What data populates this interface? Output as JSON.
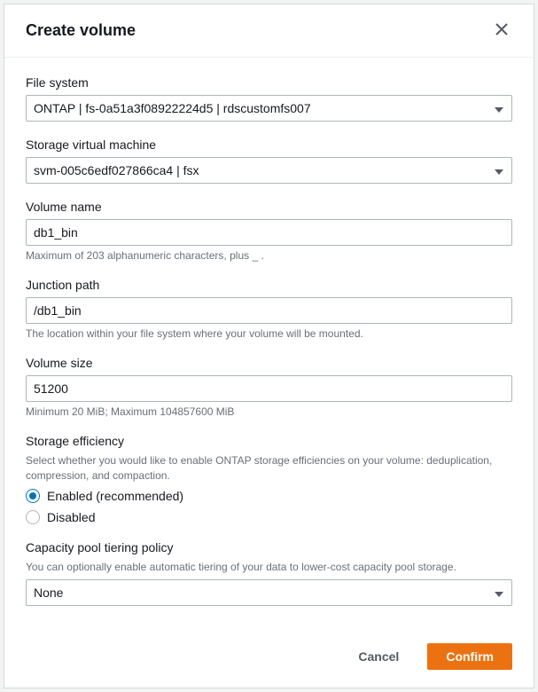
{
  "header": {
    "title": "Create volume"
  },
  "fields": {
    "file_system": {
      "label": "File system",
      "value": "ONTAP | fs-0a51a3f08922224d5 | rdscustomfs007"
    },
    "svm": {
      "label": "Storage virtual machine",
      "value": "svm-005c6edf027866ca4 | fsx"
    },
    "volume_name": {
      "label": "Volume name",
      "value": "db1_bin",
      "hint": "Maximum of 203 alphanumeric characters, plus _ ."
    },
    "junction_path": {
      "label": "Junction path",
      "value": "/db1_bin",
      "hint": "The location within your file system where your volume will be mounted."
    },
    "volume_size": {
      "label": "Volume size",
      "value": "51200",
      "hint": "Minimum 20 MiB; Maximum 104857600 MiB"
    },
    "storage_efficiency": {
      "label": "Storage efficiency",
      "description": "Select whether you would like to enable ONTAP storage efficiencies on your volume: deduplication, compression, and compaction.",
      "options": {
        "enabled": "Enabled (recommended)",
        "disabled": "Disabled"
      },
      "selected": "enabled"
    },
    "tiering_policy": {
      "label": "Capacity pool tiering policy",
      "description": "You can optionally enable automatic tiering of your data to lower-cost capacity pool storage.",
      "value": "None"
    }
  },
  "footer": {
    "cancel": "Cancel",
    "confirm": "Confirm"
  }
}
